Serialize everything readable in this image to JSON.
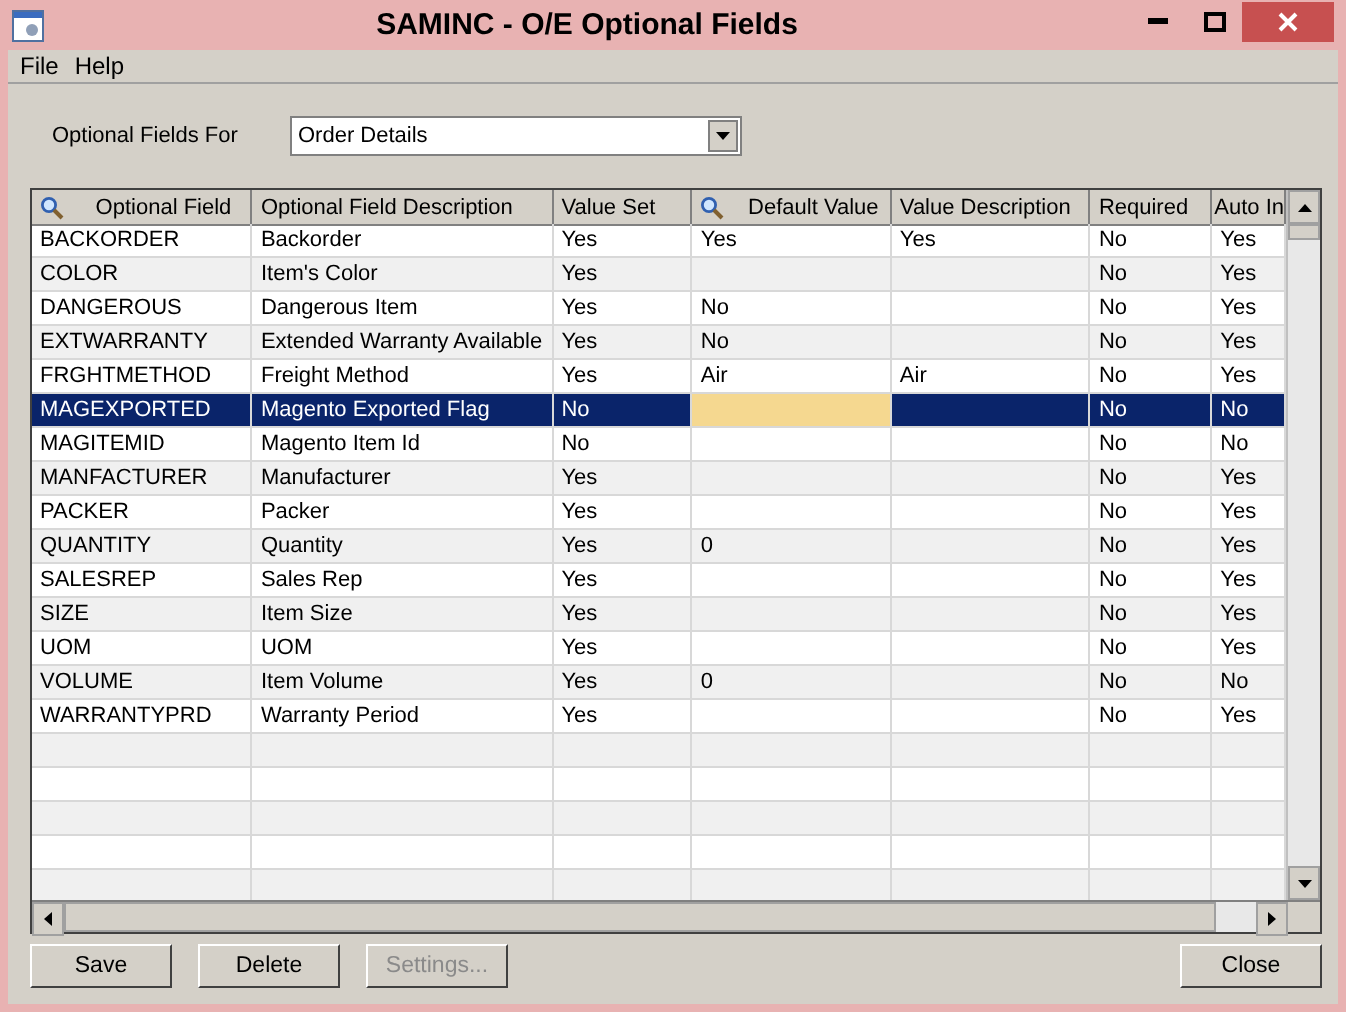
{
  "window": {
    "title": "SAMINC - O/E Optional Fields"
  },
  "menu": [
    {
      "label": "File"
    },
    {
      "label": "Help"
    }
  ],
  "filter": {
    "label": "Optional Fields For",
    "value": "Order Details"
  },
  "table": {
    "columns": [
      {
        "label": "Optional Field",
        "kind": "lookup",
        "current": false
      },
      {
        "label": "Optional Field Description",
        "kind": "plain",
        "current": false
      },
      {
        "label": "Value Set",
        "kind": "plain",
        "current": false
      },
      {
        "label": "Default Value",
        "kind": "lookup",
        "current": true
      },
      {
        "label": "Value Description",
        "kind": "plain",
        "current": false
      },
      {
        "label": "Required",
        "kind": "plain",
        "current": false
      },
      {
        "label": "Auto In",
        "kind": "plain",
        "current": false
      }
    ],
    "rows": [
      {
        "field": "BACKORDER",
        "description": "Backorder",
        "value_set": "Yes",
        "default_value": "Yes",
        "value_description": "Yes",
        "required": "No",
        "auto_insert": "Yes",
        "selected": false
      },
      {
        "field": "COLOR",
        "description": "Item's Color",
        "value_set": "Yes",
        "required": "No",
        "auto_insert": "Yes",
        "selected": false
      },
      {
        "field": "DANGEROUS",
        "description": "Dangerous Item",
        "value_set": "Yes",
        "default_value": "No",
        "required": "No",
        "auto_insert": "Yes",
        "selected": false
      },
      {
        "field": "EXTWARRANTY",
        "description": "Extended Warranty Available",
        "value_set": "Yes",
        "default_value": "No",
        "required": "No",
        "auto_insert": "Yes",
        "selected": false
      },
      {
        "field": "FRGHTMETHOD",
        "description": "Freight Method",
        "value_set": "Yes",
        "default_value": "Air",
        "value_description": "Air",
        "required": "No",
        "auto_insert": "Yes",
        "selected": false
      },
      {
        "field": "MAGEXPORTED",
        "description": "Magento Exported Flag",
        "value_set": "No",
        "required": "No",
        "auto_insert": "No",
        "selected": true
      },
      {
        "field": "MAGITEMID",
        "description": "Magento Item Id",
        "value_set": "No",
        "required": "No",
        "auto_insert": "No",
        "selected": false
      },
      {
        "field": "MANFACTURER",
        "description": "Manufacturer",
        "value_set": "Yes",
        "required": "No",
        "auto_insert": "Yes",
        "selected": false
      },
      {
        "field": "PACKER",
        "description": "Packer",
        "value_set": "Yes",
        "required": "No",
        "auto_insert": "Yes",
        "selected": false
      },
      {
        "field": "QUANTITY",
        "description": "Quantity",
        "value_set": "Yes",
        "default_value": "0",
        "required": "No",
        "auto_insert": "Yes",
        "selected": false
      },
      {
        "field": "SALESREP",
        "description": "Sales Rep",
        "value_set": "Yes",
        "required": "No",
        "auto_insert": "Yes",
        "selected": false
      },
      {
        "field": "SIZE",
        "description": "Item Size",
        "value_set": "Yes",
        "required": "No",
        "auto_insert": "Yes",
        "selected": false
      },
      {
        "field": "UOM",
        "description": "UOM",
        "value_set": "Yes",
        "required": "No",
        "auto_insert": "Yes",
        "selected": false
      },
      {
        "field": "VOLUME",
        "description": "Item Volume",
        "value_set": "Yes",
        "default_value": "0",
        "required": "No",
        "auto_insert": "No",
        "selected": false
      },
      {
        "field": "WARRANTYPRD",
        "description": "Warranty Period",
        "value_set": "Yes",
        "required": "No",
        "auto_insert": "Yes",
        "selected": false
      }
    ]
  },
  "buttons": [
    {
      "label": "Save",
      "disabled": false
    },
    {
      "label": "Delete",
      "disabled": false
    },
    {
      "label": "Settings...",
      "disabled": true
    },
    {
      "label": "Close",
      "disabled": false
    }
  ]
}
